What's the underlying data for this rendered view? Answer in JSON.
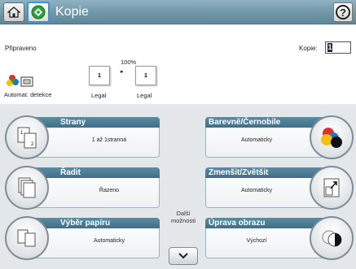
{
  "titlebar": {
    "title": "Kopie",
    "home_icon": "home-icon",
    "app_icon": "copy-app-icon",
    "help_icon": "help-icon",
    "help_glyph": "?"
  },
  "status": {
    "text": "Připraveno",
    "copies_label": "Kopie:",
    "copies_value": "1"
  },
  "preview": {
    "color_mode_label": "Automat. detekce",
    "zoom": "100%",
    "arrow": "▸",
    "original_page_number": "1",
    "copy_page_number": "1",
    "original_size": "Legal",
    "copy_size": "Legal"
  },
  "options": {
    "sides": {
      "title": "Strany",
      "value": "1 až 1stranná"
    },
    "collate": {
      "title": "Řadit",
      "value": "Řazeno"
    },
    "paper": {
      "title": "Výběr papíru",
      "value": "Automaticky"
    },
    "color": {
      "title": "Barevně/Černobile",
      "value": "Automaticky"
    },
    "reduce": {
      "title": "Zmenšit/Zvětšit",
      "value": "Automaticky"
    },
    "image_adjust": {
      "title": "Úprava obrazu",
      "value": "Výchozí"
    }
  },
  "more_options": {
    "label_line1": "Další",
    "label_line2": "možnosti"
  },
  "colors": {
    "titlebar": "#6f97a8",
    "tile_header": "#4a7d95",
    "accent_blue": "#3c92d8"
  }
}
